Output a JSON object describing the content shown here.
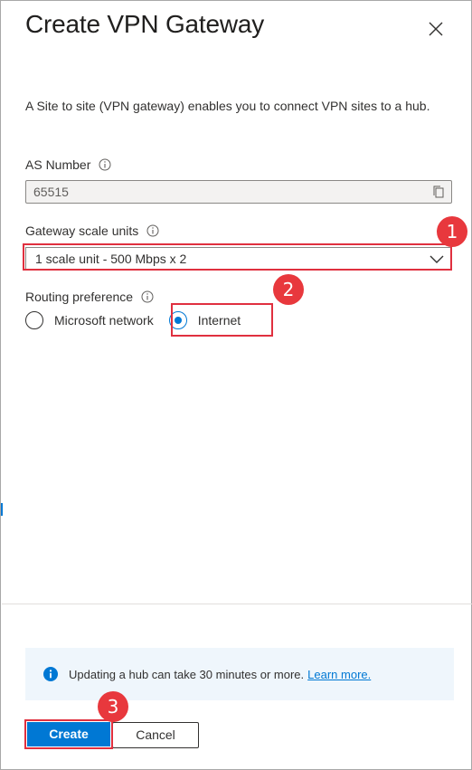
{
  "header": {
    "title": "Create VPN Gateway",
    "close_icon": "close-icon"
  },
  "description": "A Site to site (VPN gateway) enables you to connect VPN sites to a hub.",
  "as_number": {
    "label": "AS Number",
    "value": "65515",
    "copy_icon": "copy-icon"
  },
  "gateway_scale": {
    "label": "Gateway scale units",
    "selected": "1 scale unit - 500 Mbps x 2"
  },
  "routing": {
    "label": "Routing preference",
    "options": [
      {
        "label": "Microsoft network",
        "checked": false
      },
      {
        "label": "Internet",
        "checked": true
      }
    ]
  },
  "notice": {
    "text": "Updating a hub can take 30 minutes or more.",
    "link": "Learn more."
  },
  "footer": {
    "create_label": "Create",
    "cancel_label": "Cancel"
  },
  "annotations": {
    "step1": "1",
    "step2": "2",
    "step3": "3",
    "highlight_color": "#e0303f"
  },
  "colors": {
    "accent": "#0078d4",
    "badge": "#e8383d"
  }
}
